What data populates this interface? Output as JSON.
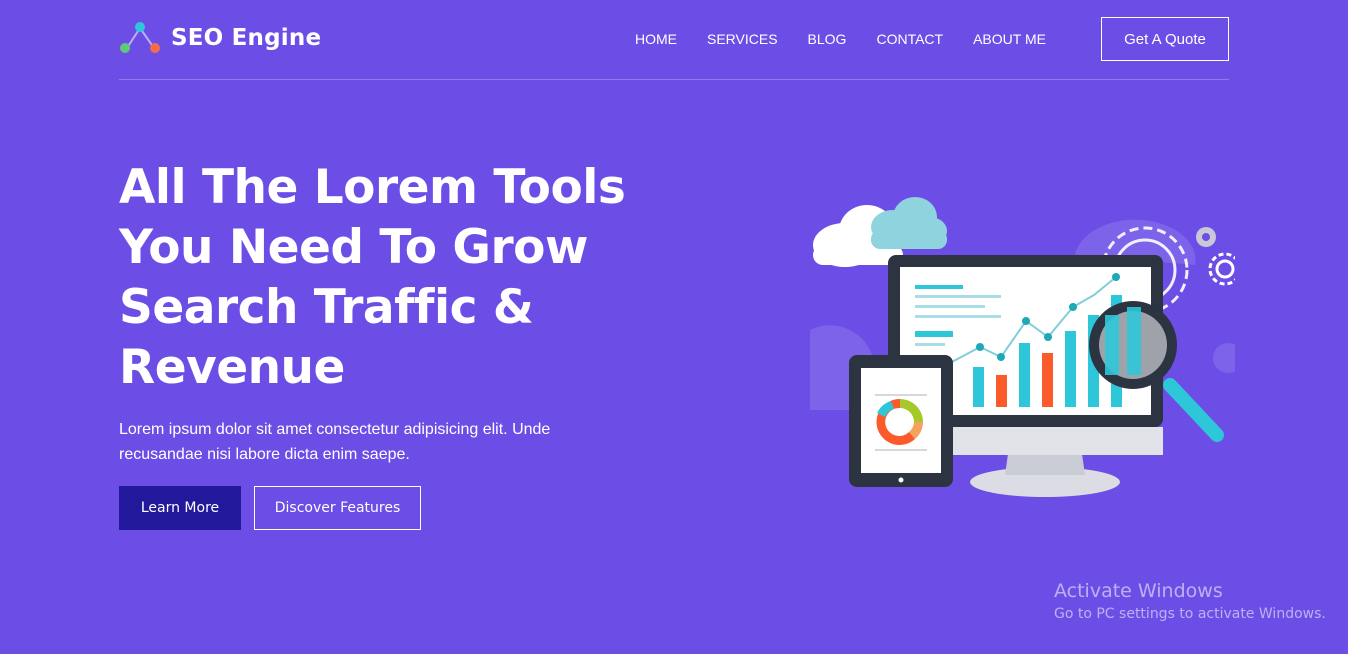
{
  "brand": {
    "name": "SEO Engine",
    "icon": "network-nodes-icon"
  },
  "nav": {
    "items": [
      "HOME",
      "SERVICES",
      "BLOG",
      "CONTACT",
      "ABOUT ME"
    ],
    "quote_label": "Get A Quote"
  },
  "hero": {
    "title": "All The Lorem Tools You Need To Grow Search Traffic & Revenue",
    "text": "Lorem ipsum dolor sit amet consectetur adipisicing elit. Unde recusandae nisi labore dicta enim saepe.",
    "primary_label": "Learn More",
    "secondary_label": "Discover Features",
    "illustration": "seo-analytics-illustration"
  },
  "watermark": {
    "title": "Activate Windows",
    "subtitle": "Go to PC settings to activate Windows."
  },
  "colors": {
    "background": "#6c4ee6",
    "primary_button": "#22189b",
    "chart_teal": "#2ec7d9",
    "chart_orange": "#fb5b2a"
  }
}
